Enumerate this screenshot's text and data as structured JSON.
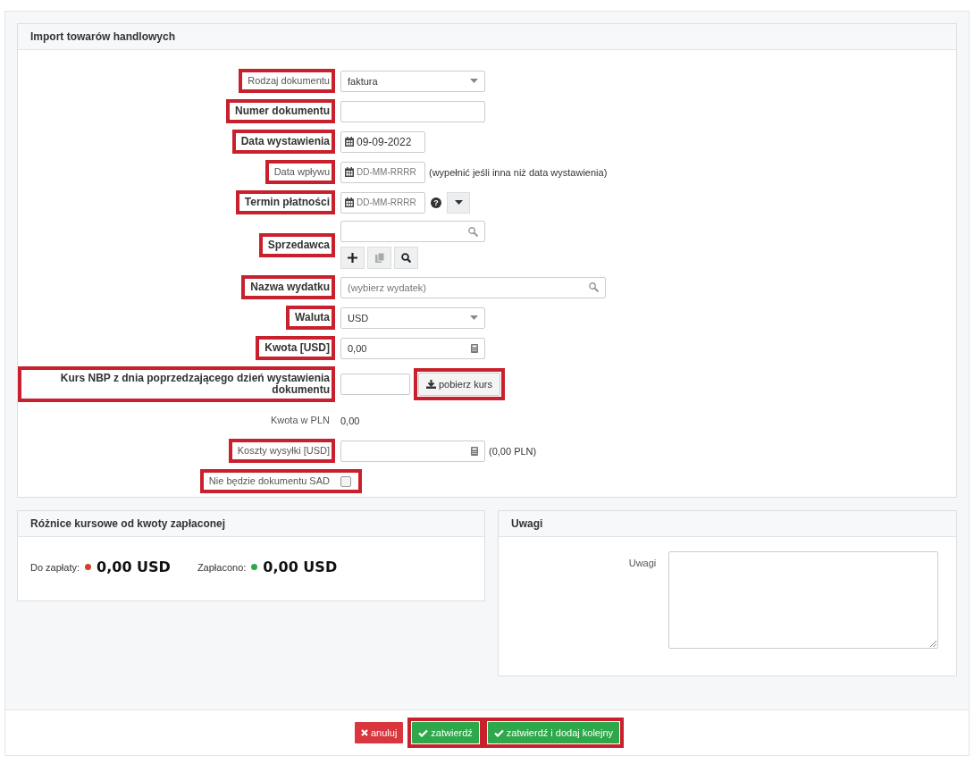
{
  "panel": {
    "title": "Import towarów handlowych"
  },
  "fields": [
    {
      "kind": "select",
      "label": "Rodzaj dokumentu",
      "bold": false,
      "highlighted": true,
      "value": "faktura"
    },
    {
      "kind": "text",
      "label": "Numer dokumentu",
      "bold": true,
      "highlighted": true
    },
    {
      "kind": "date",
      "label": "Data wystawienia",
      "bold": true,
      "highlighted": true,
      "value": "09-09-2022"
    },
    {
      "kind": "date",
      "label": "Data wpływu",
      "bold": false,
      "highlighted": true,
      "placeholder": "DD-MM-RRRR",
      "note": "(wypełnić jeśli inna niż data wystawienia)"
    },
    {
      "kind": "date",
      "label": "Termin płatności",
      "bold": true,
      "highlighted": true,
      "placeholder": "DD-MM-RRRR",
      "help": "?",
      "dropdown": true
    },
    {
      "kind": "search",
      "label": "Sprzedawca",
      "bold": true,
      "highlighted": true,
      "wide": false,
      "actions": [
        {
          "kind": "plus",
          "disabled": false
        },
        {
          "kind": "copy",
          "disabled": true
        },
        {
          "kind": "search",
          "disabled": false
        }
      ]
    },
    {
      "kind": "search",
      "label": "Nazwa wydatku",
      "bold": true,
      "highlighted": true,
      "wide": true,
      "placeholder": "(wybierz wydatek)"
    },
    {
      "kind": "select",
      "label": "Waluta",
      "bold": true,
      "highlighted": true,
      "value": "USD"
    },
    {
      "kind": "amount",
      "label": "Kwota [USD]",
      "bold": true,
      "highlighted": true,
      "value": "0,00"
    },
    {
      "kind": "rate",
      "label": "Kurs NBP z dnia poprzedzającego dzień wystawienia dokumentu",
      "bold": true,
      "highlighted": true,
      "button": {
        "label": "pobierz kurs",
        "highlighted": true
      }
    },
    {
      "kind": "static",
      "label": "Kwota w PLN",
      "bold": false,
      "highlighted": false,
      "value": "0,00"
    },
    {
      "kind": "amount",
      "label": "Koszty wysyłki [USD]",
      "bold": false,
      "highlighted": true,
      "note": "(0,00 PLN)"
    },
    {
      "kind": "checkbox",
      "label": "Nie będzie dokumentu SAD",
      "bold": false,
      "highlighted": true,
      "checked": false
    }
  ],
  "rates_panel": {
    "title": "Różnice kursowe od kwoty zapłaconej",
    "items": [
      {
        "label": "Do zapłaty:",
        "color": "#d0402b",
        "value": "0,00 USD"
      },
      {
        "label": "Zapłacono:",
        "color": "#2ea84a",
        "value": "0,00 USD"
      }
    ]
  },
  "notes_panel": {
    "title": "Uwagi",
    "label": "Uwagi"
  },
  "buttons": [
    {
      "kind": "cancel",
      "label": "anuluj",
      "highlighted": false
    },
    {
      "kind": "confirm",
      "label": "zatwierdź",
      "highlighted": true
    },
    {
      "kind": "confirm",
      "label": "zatwierdź i dodaj kolejny",
      "highlighted": true
    }
  ]
}
